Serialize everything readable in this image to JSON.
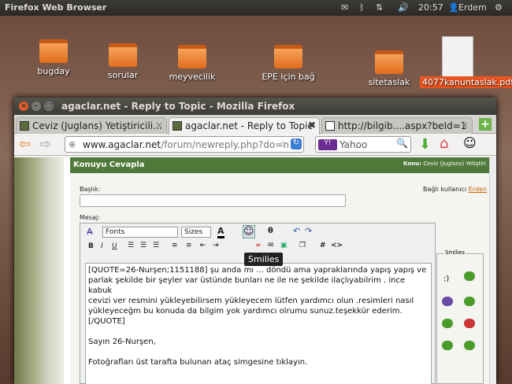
{
  "panel": {
    "app": "Firefox Web Browser",
    "time": "20:57",
    "user": "Erdem"
  },
  "desktop": {
    "icons": [
      {
        "label": "bugday"
      },
      {
        "label": "sorular"
      },
      {
        "label": "meyvecilik"
      },
      {
        "label": "EPE için bağ"
      },
      {
        "label": "sitetaslak"
      },
      {
        "label": "4077kanuntaslak.pdf"
      }
    ]
  },
  "window": {
    "title": "agaclar.net - Reply to Topic - Mozilla Firefox"
  },
  "tabs": [
    {
      "label": "Ceviz (Juglans) Yetiştiricili..."
    },
    {
      "label": "agaclar.net - Reply to Topic"
    },
    {
      "label": "http://bilgib....aspx?beId=1"
    }
  ],
  "nav": {
    "url_domain": "www.agaclar.net",
    "url_path": "/forum/newreply.php?do=n",
    "search_placeholder": "Yahoo"
  },
  "forum": {
    "header": "Konuyu Cevapla",
    "topic_label": "Konu:",
    "topic": "Ceviz (Juglans) Yetiştiri",
    "title_label": "Başlık:",
    "linked_user": "Bağlı kullanıcı",
    "linked_user_name": "Erden",
    "message_label": "Mesaj:"
  },
  "editor": {
    "font": "Fonts",
    "size": "Sizes",
    "tooltip": "Smilies",
    "smilies_label": "Smilies",
    "lines": [
      "[QUOTE=26-Nurşen;1151188] şu anda mı ... döndü ama yapraklarında yapış yapış ve",
      "parlak şekilde  bir şeyler var üstünde  bunları ne ile ne şekilde ilaçlıyabilrim  . ince kabuk",
      "cevizi ver resmini yükleyebilirsem yükleyecem lütfen  yardımcı olun .resimleri nasıl",
      "yükleyeceğm bu konuda da bilgim yok yardımcı olrumu sunuz.teşekkür ederim.[/QUOTE]",
      "",
      "Sayın 26-Nurşen,",
      "",
      "Fotoğrafları üst tarafta bulunan ataç simgesine tıklayın."
    ]
  },
  "smiley_text": ":)"
}
